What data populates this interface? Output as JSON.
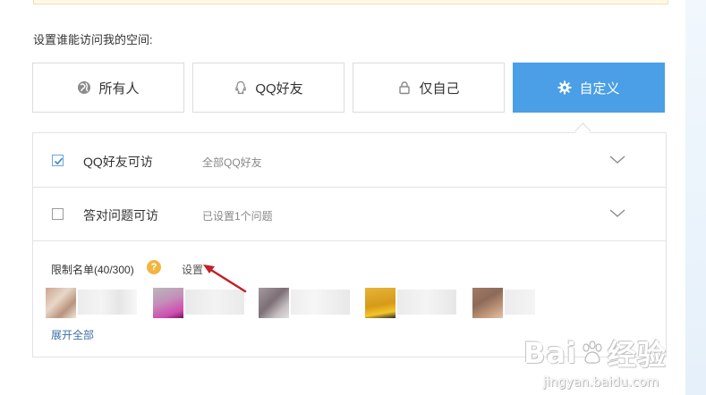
{
  "prompt": "设置谁能访问我的空间:",
  "options": [
    {
      "label": "所有人",
      "icon": "globe-icon",
      "selected": false
    },
    {
      "label": "QQ好友",
      "icon": "qq-penguin-icon",
      "selected": false
    },
    {
      "label": "仅自己",
      "icon": "lock-icon",
      "selected": false
    },
    {
      "label": "自定义",
      "icon": "gear-icon",
      "selected": true
    }
  ],
  "rules": [
    {
      "label": "QQ好友可访",
      "description": "全部QQ好友",
      "checked": true
    },
    {
      "label": "答对问题可访",
      "description": "已设置1个问题",
      "checked": false
    }
  ],
  "limit_list": {
    "label": "限制名单(40/300)",
    "help": "?",
    "set_link": "设置",
    "expand_all": "展开全部"
  },
  "watermark": {
    "brand": "Bai",
    "brand_tail": "经验",
    "url": "jingyan.baidu.com"
  },
  "colors": {
    "accent": "#4a9fe6",
    "help": "#f2b540",
    "link": "#3e6fa8",
    "arrow": "#c0202a"
  }
}
